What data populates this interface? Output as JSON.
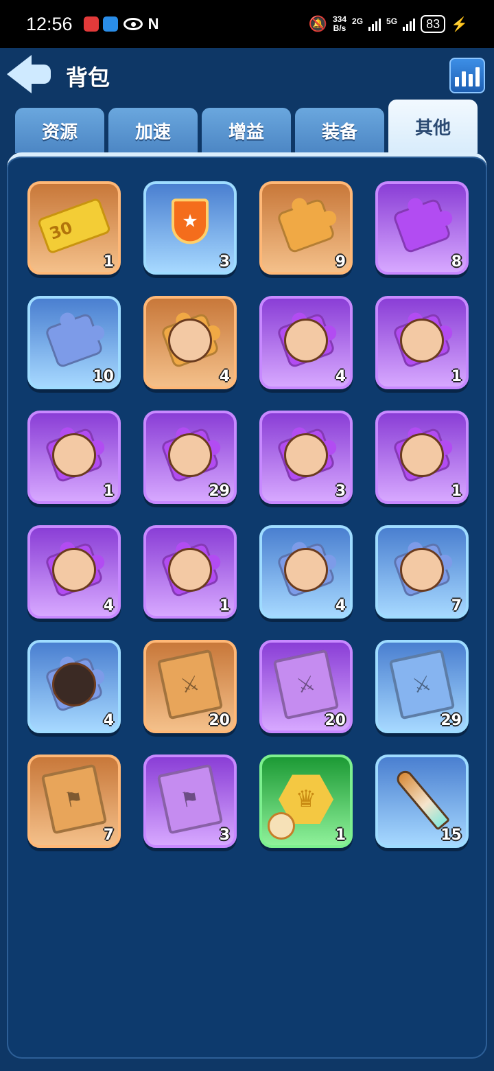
{
  "status_bar": {
    "time": "12:56",
    "speed_value": "334",
    "speed_unit": "B/s",
    "net_2g": "2G",
    "net_5g": "5G",
    "battery": "83"
  },
  "header": {
    "title": "背包"
  },
  "tabs": [
    {
      "label": "资源",
      "active": false
    },
    {
      "label": "加速",
      "active": false
    },
    {
      "label": "增益",
      "active": false
    },
    {
      "label": "装备",
      "active": false
    },
    {
      "label": "其他",
      "active": true
    }
  ],
  "items": [
    {
      "icon": "ticket-30",
      "rarity": "orange",
      "count": "1"
    },
    {
      "icon": "banner-badge",
      "rarity": "blue",
      "count": "3"
    },
    {
      "icon": "puzzle-piece",
      "rarity": "orange",
      "count": "9"
    },
    {
      "icon": "puzzle-piece",
      "rarity": "purple",
      "count": "8"
    },
    {
      "icon": "puzzle-piece",
      "rarity": "blue",
      "count": "10"
    },
    {
      "icon": "hero-fragment",
      "rarity": "orange",
      "count": "4"
    },
    {
      "icon": "hero-fragment",
      "rarity": "purple",
      "count": "4"
    },
    {
      "icon": "hero-fragment",
      "rarity": "purple",
      "count": "1"
    },
    {
      "icon": "hero-fragment",
      "rarity": "purple",
      "count": "1"
    },
    {
      "icon": "hero-fragment",
      "rarity": "purple",
      "count": "29"
    },
    {
      "icon": "hero-fragment",
      "rarity": "purple",
      "count": "3"
    },
    {
      "icon": "hero-fragment",
      "rarity": "purple",
      "count": "1"
    },
    {
      "icon": "hero-fragment",
      "rarity": "purple",
      "count": "4"
    },
    {
      "icon": "hero-fragment",
      "rarity": "purple",
      "count": "1"
    },
    {
      "icon": "hero-fragment",
      "rarity": "blue",
      "count": "4"
    },
    {
      "icon": "hero-fragment",
      "rarity": "blue",
      "count": "7"
    },
    {
      "icon": "hero-fragment",
      "rarity": "blue",
      "count": "4"
    },
    {
      "icon": "skill-book-swords",
      "rarity": "orange",
      "count": "20"
    },
    {
      "icon": "skill-book-swords",
      "rarity": "purple",
      "count": "20"
    },
    {
      "icon": "skill-book-swords",
      "rarity": "blue",
      "count": "29"
    },
    {
      "icon": "skill-book-flag",
      "rarity": "orange",
      "count": "7"
    },
    {
      "icon": "skill-book-flag",
      "rarity": "purple",
      "count": "3"
    },
    {
      "icon": "crown-token-timer",
      "rarity": "green",
      "count": "1"
    },
    {
      "icon": "spear-tip",
      "rarity": "blue",
      "count": "15"
    }
  ],
  "colors": {
    "background": "#0e3766",
    "orange": "#f4c08a",
    "purple": "#d7a8ff",
    "blue": "#a6d8ff",
    "green": "#8ff19a"
  }
}
